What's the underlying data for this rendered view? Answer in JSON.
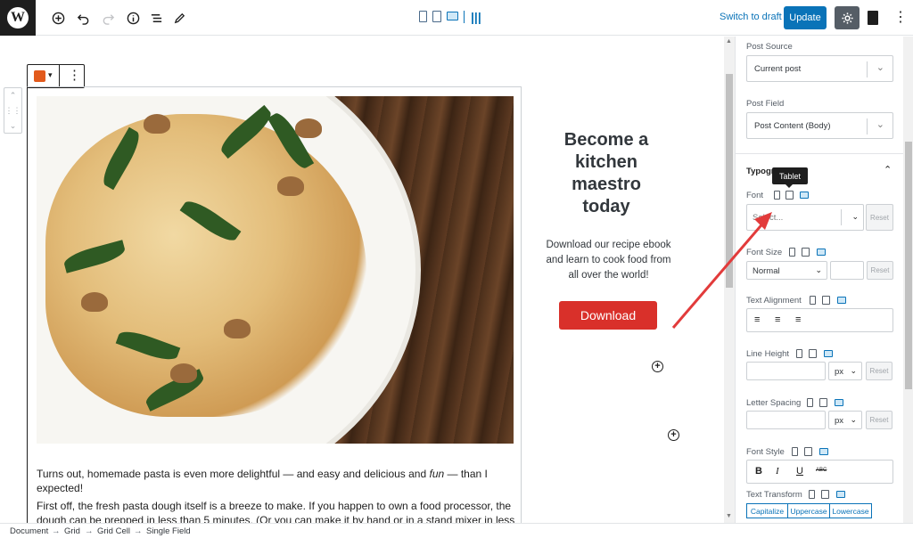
{
  "toolbar": {
    "logo_letter": "W",
    "switch_draft_label": "Switch to draft",
    "update_label": "Update",
    "add_icon": "plus-circle-icon",
    "undo_icon": "undo-icon",
    "redo_icon": "redo-icon",
    "info_icon": "info-icon",
    "outline_icon": "list-outline-icon",
    "tools_icon": "pencil-icon"
  },
  "content": {
    "promo_title_lines": [
      "Become a",
      "kitchen",
      "maestro",
      "today"
    ],
    "promo_desc_lines": [
      "Download our recipe ebook",
      "and learn to cook food from",
      "all over the world!"
    ],
    "download_label": "Download",
    "para1_before": "Turns out, homemade pasta is even more delightful — and easy and delicious and ",
    "para1_italic": "fun",
    "para1_after": " — than I expected!",
    "para2_line1": "First off, the fresh pasta dough itself is a breeze to make.  If you happen to own a food processor, the",
    "para2_line2": "dough can be prepped in less than 5 minutes.  (Or you can make it by hand or in a stand mixer in less"
  },
  "sidebar": {
    "post_source_label": "Post Source",
    "post_source_value": "Current post",
    "post_field_label": "Post Field",
    "post_field_value": "Post Content (Body)",
    "typography_heading": "Typogr",
    "tooltip": "Tablet",
    "font_label": "Font",
    "font_placeholder": "Select...",
    "reset_label": "Reset",
    "font_size_label": "Font Size",
    "font_size_value": "Normal",
    "text_alignment_label": "Text Alignment",
    "line_height_label": "Line Height",
    "unit_px": "px",
    "letter_spacing_label": "Letter Spacing",
    "font_style_label": "Font Style",
    "text_transform_label": "Text Transform",
    "transform_options": [
      "Capitalize",
      "Uppercase",
      "Lowercase"
    ],
    "style_buttons": [
      "B",
      "I",
      "U",
      "ABC"
    ]
  },
  "breadcrumb": [
    "Document",
    "Grid",
    "Grid Cell",
    "Single Field"
  ],
  "colors": {
    "accent": "#0a73b8",
    "download_button": "#d9302a",
    "annotation_arrow": "#e23b3b",
    "toolbar_dark": "#1e1e1e"
  }
}
